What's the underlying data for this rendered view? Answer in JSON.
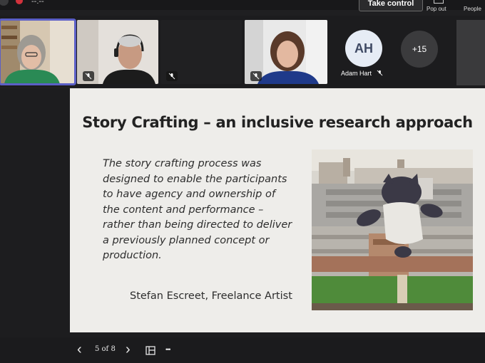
{
  "meeting": {
    "timer": "--:--",
    "take_control_label": "Take control",
    "popout_label": "Pop out",
    "people_label": "People"
  },
  "participants": [
    {
      "id": "p1",
      "muted": false
    },
    {
      "id": "p2",
      "muted": true
    },
    {
      "id": "p3",
      "muted": true
    },
    {
      "id": "p4",
      "muted": true
    },
    {
      "initials": "AH",
      "name": "Adam Hart",
      "muted": true
    },
    {
      "overflow_label": "+15"
    }
  ],
  "slide": {
    "title": "Story Crafting – an inclusive research approach",
    "quote_lines": [
      "The story crafting process was",
      "designed to enable the participants",
      "to have agency and ownership of",
      "the content and performance –",
      "rather than being directed to deliver",
      "a previously planned concept or",
      "production."
    ],
    "attribution": "Stefan Escreet, Freelance Artist"
  },
  "controls": {
    "prev_icon": "‹",
    "page_indicator": "5 of 8",
    "next_icon": "›",
    "more_icon": "•••"
  },
  "colors": {
    "active_speaker": "#5b5fc7",
    "background": "#1f1f21",
    "slide": "#eeedea"
  }
}
